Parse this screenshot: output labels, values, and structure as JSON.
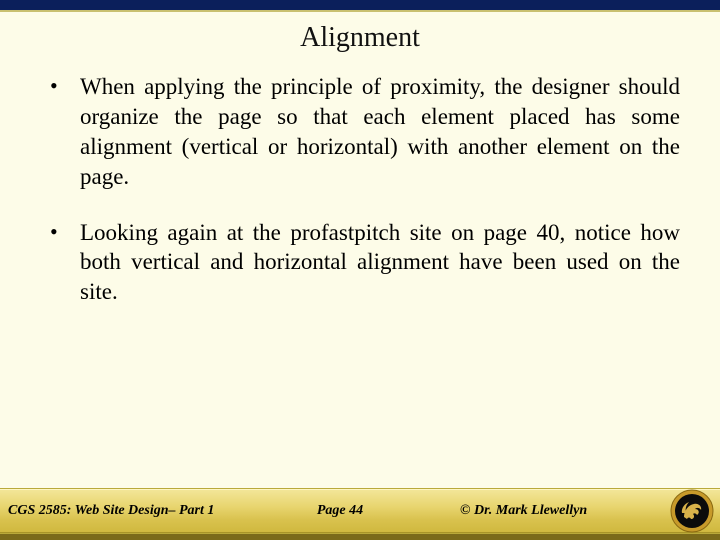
{
  "title": "Alignment",
  "bullets": [
    "When applying the principle of proximity, the designer should organize the page so that each element placed has some alignment (vertical or horizontal) with another element on the page.",
    "Looking again at the profastpitch site on page 40, notice how both vertical and horizontal alignment have been used on the site."
  ],
  "footer": {
    "course": "CGS 2585: Web Site Design– Part 1",
    "page": "Page 44",
    "copyright": "© Dr. Mark Llewellyn"
  }
}
